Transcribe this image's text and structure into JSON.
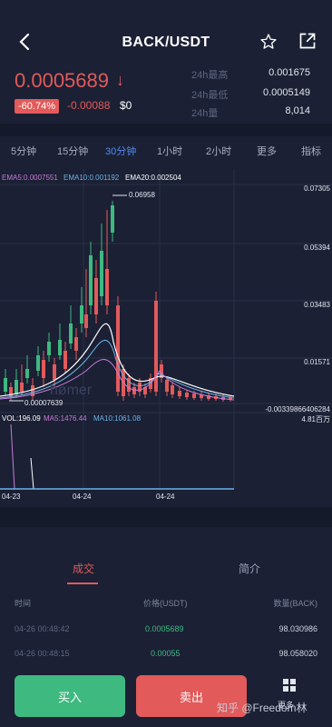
{
  "header": {
    "title": "BACK/USDT"
  },
  "ticker": {
    "price": "0.0005689",
    "arrow": "↓",
    "change_pct": "-60.74%",
    "change_abs": "-0.00088",
    "usd": "$0",
    "high_label": "24h最高",
    "high_value": "0.001675",
    "low_label": "24h最低",
    "low_value": "0.0005149",
    "vol_label": "24h量",
    "vol_value": "8,014"
  },
  "intervals": [
    "5分钟",
    "15分钟",
    "30分钟",
    "1小时",
    "2小时",
    "更多",
    "指标"
  ],
  "active_interval": "30分钟",
  "chart_data": {
    "type": "candlestick",
    "indicators": [
      {
        "name": "EMA5",
        "value": "0.0007551",
        "color": "#c77bd6"
      },
      {
        "name": "EMA10",
        "value": "0.001192",
        "color": "#6db3e8"
      },
      {
        "name": "EMA20",
        "value": "0.002504",
        "color": "#ffffff"
      }
    ],
    "y_ticks": [
      "0.07305",
      "0.05394",
      "0.03483",
      "0.01571",
      "-0.00339866406284"
    ],
    "max_label": "0.06958",
    "min_label": "0.00007639",
    "x_ticks": [
      "04-23",
      "04-24",
      "04-24"
    ],
    "volume": {
      "vol": "196.09",
      "ma5": "1476.44",
      "ma10": "1061.08",
      "max_label": "4.81百万"
    },
    "watermark": "hømer"
  },
  "trades": {
    "tabs": [
      "成交",
      "简介"
    ],
    "active": "成交",
    "columns": [
      "时间",
      "价格(USDT)",
      "数量(BACK)"
    ],
    "rows": [
      {
        "time": "04-26 00:48:42",
        "price": "0.0005689",
        "qty": "98.030986"
      },
      {
        "time": "04-26 00:48:15",
        "price": "0.00055",
        "qty": "98.058020"
      }
    ]
  },
  "actions": {
    "buy": "买入",
    "sell": "卖出",
    "more": "更多"
  },
  "watermark": "知乎 @Freedom林",
  "colors": {
    "up": "#3eb980",
    "down": "#e25a5a",
    "accent": "#4f8bf0",
    "bg": "#1b2034"
  }
}
